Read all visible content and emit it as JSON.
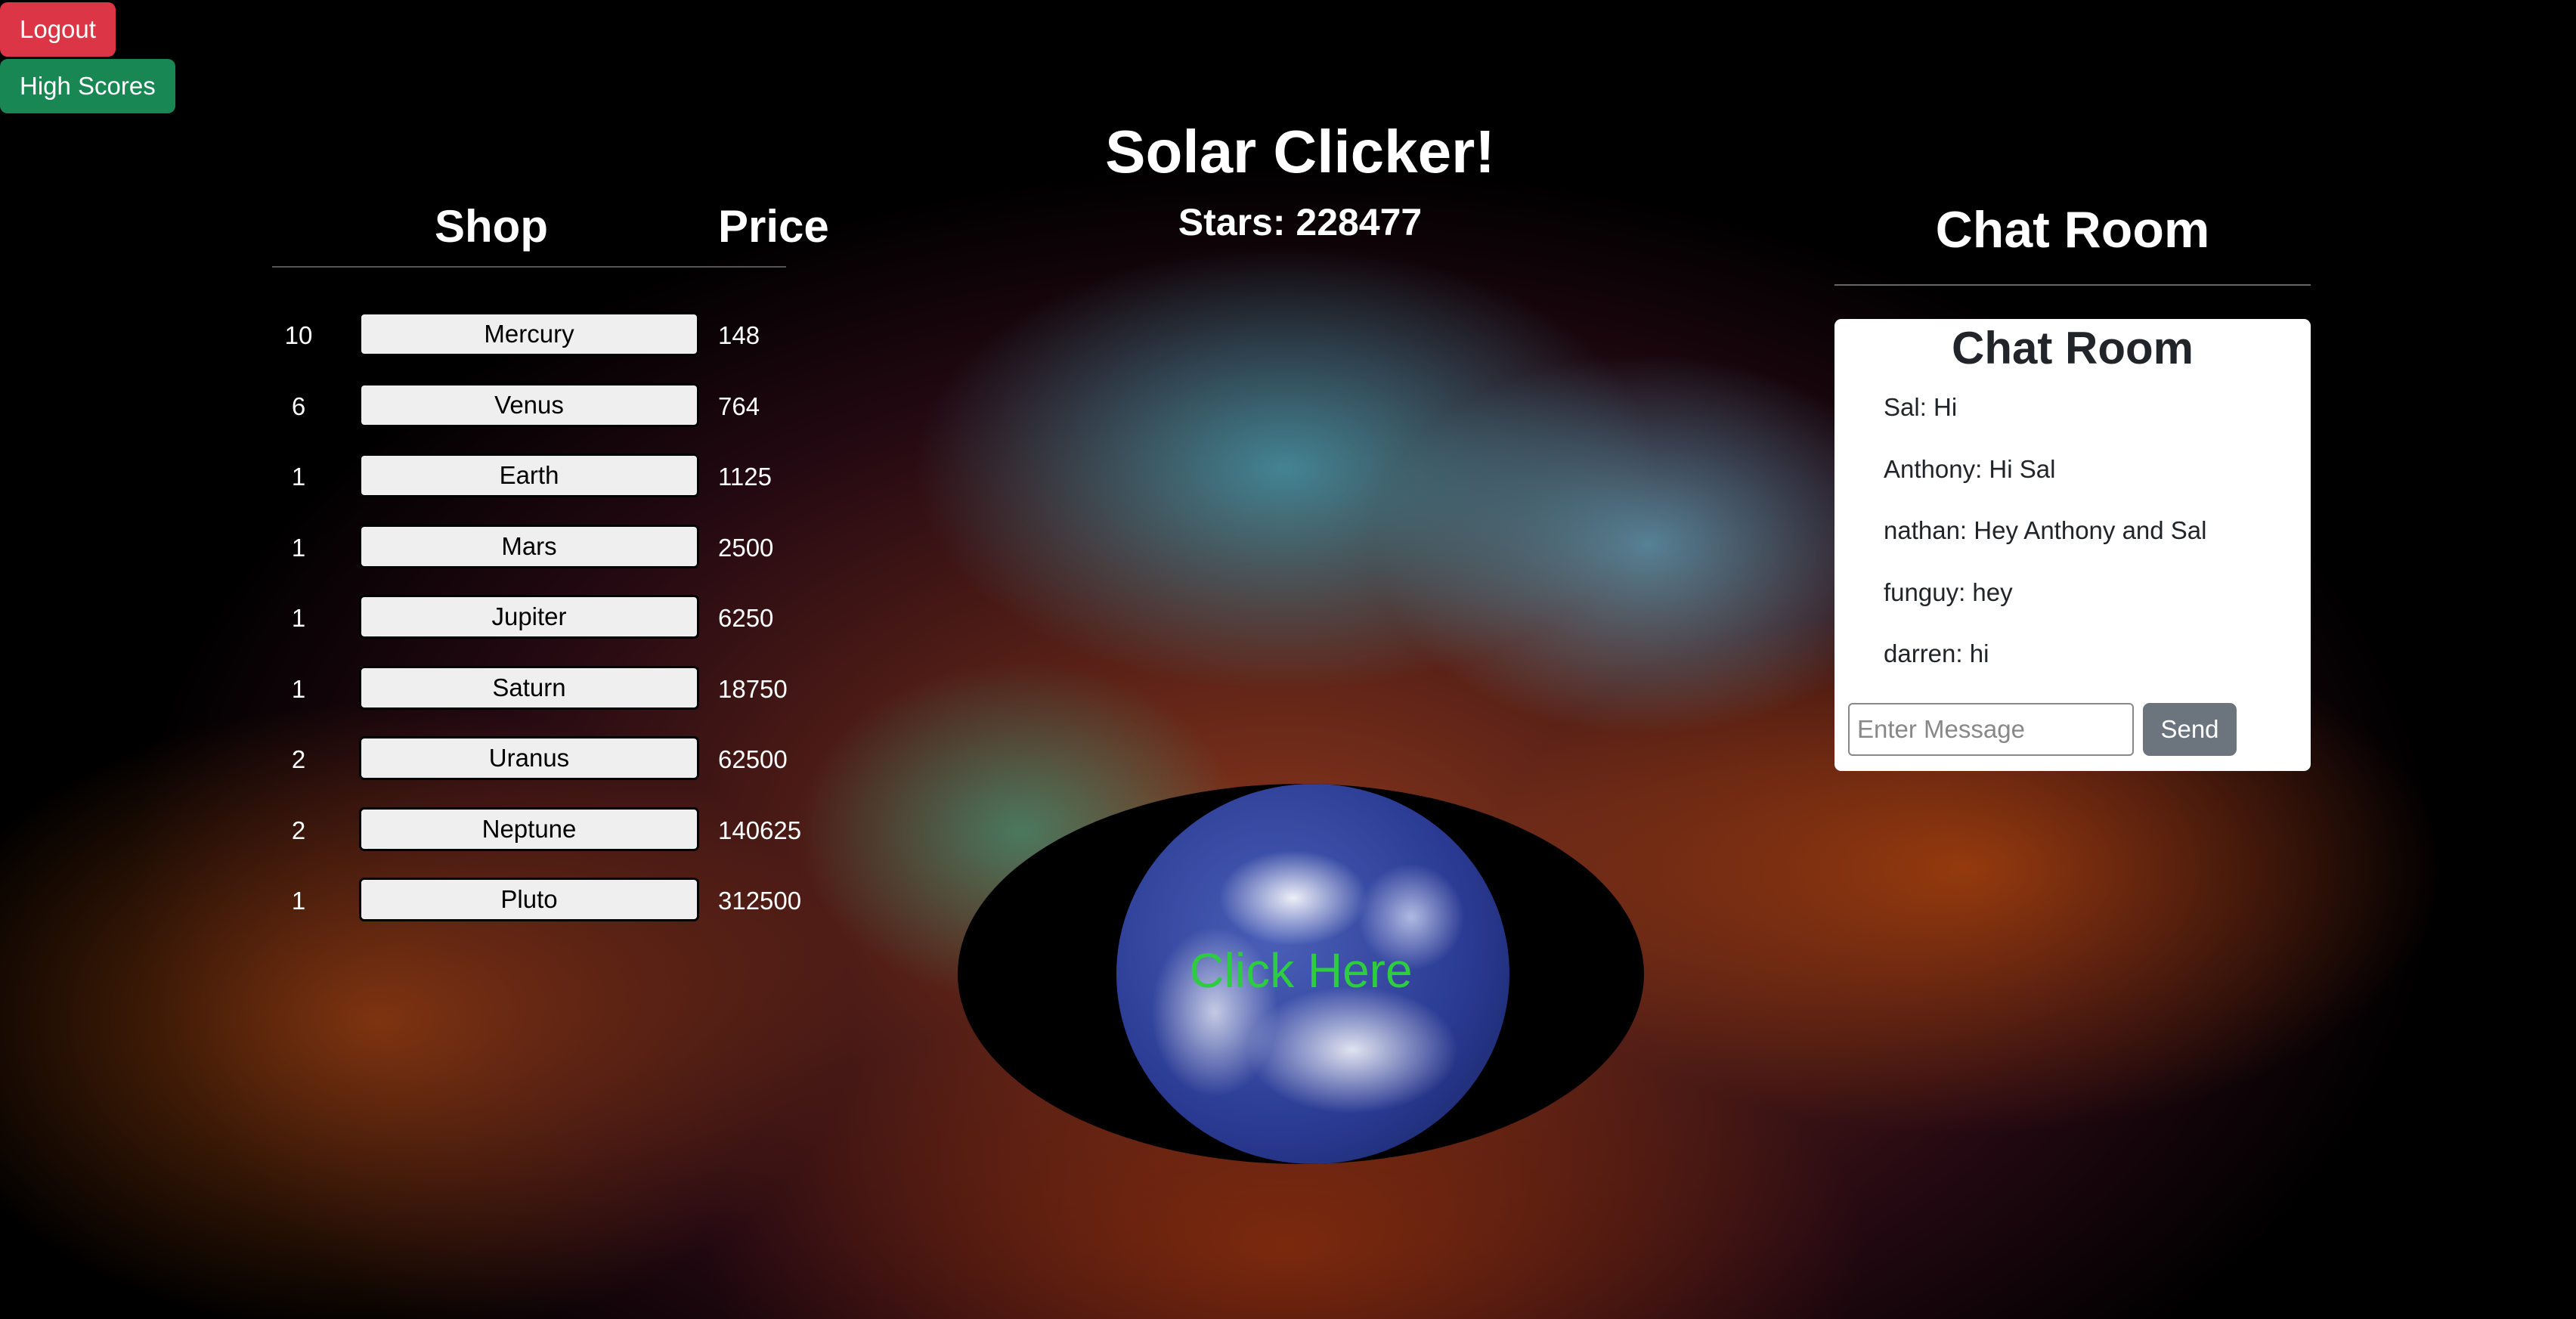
{
  "nav": {
    "logout": "Logout",
    "high_scores": "High Scores"
  },
  "header": {
    "title": "Solar Clicker!",
    "stars": "Stars: 228477"
  },
  "shop": {
    "title": "Shop",
    "price_title": "Price",
    "items": [
      {
        "count": "10",
        "name": "Mercury",
        "price": "148"
      },
      {
        "count": "6",
        "name": "Venus",
        "price": "764"
      },
      {
        "count": "1",
        "name": "Earth",
        "price": "1125"
      },
      {
        "count": "1",
        "name": "Mars",
        "price": "2500"
      },
      {
        "count": "1",
        "name": "Jupiter",
        "price": "6250"
      },
      {
        "count": "1",
        "name": "Saturn",
        "price": "18750"
      },
      {
        "count": "2",
        "name": "Uranus",
        "price": "62500"
      },
      {
        "count": "2",
        "name": "Neptune",
        "price": "140625"
      },
      {
        "count": "1",
        "name": "Pluto",
        "price": "312500"
      }
    ]
  },
  "chat": {
    "heading": "Chat Room",
    "box_title": "Chat Room",
    "messages": [
      "Sal: Hi",
      "Anthony: Hi Sal",
      "nathan: Hey Anthony and Sal",
      "funguy: hey",
      "darren: hi"
    ],
    "input_placeholder": "Enter Message",
    "send": "Send"
  },
  "clicker": {
    "label": "Click Here"
  }
}
